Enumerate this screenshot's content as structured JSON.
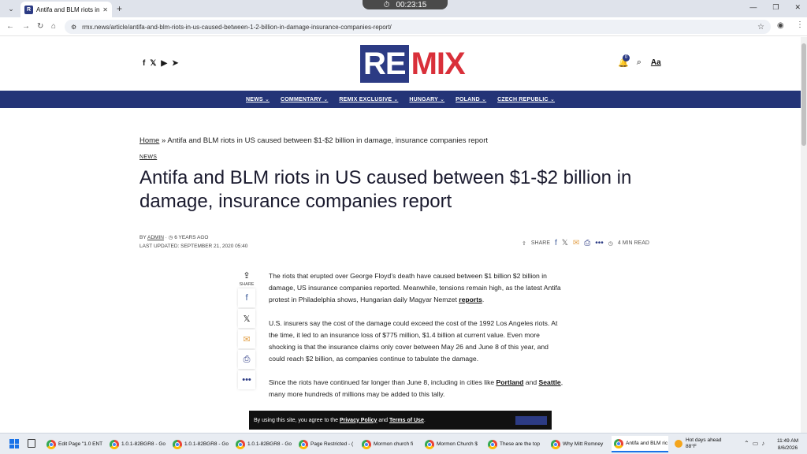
{
  "browser": {
    "tab_title": "Antifa and BLM riots in US caus",
    "tab_favicon": "R",
    "timer": "00:23:15",
    "url": "rmx.news/article/antifa-and-blm-riots-in-us-caused-between-1-2-billion-in-damage-insurance-companies-report/"
  },
  "site": {
    "logo_left": "RE",
    "logo_right": "MIX",
    "notif_count": "0",
    "font_toggle": "Aa",
    "nav": [
      "NEWS",
      "COMMENTARY",
      "REMIX EXCLUSIVE",
      "HUNGARY",
      "POLAND",
      "CZECH REPUBLIC"
    ],
    "brand_colors": {
      "navy": "#243477",
      "red": "#d9303a"
    }
  },
  "article": {
    "breadcrumb_home": "Home",
    "breadcrumb_rest": " » Antifa and BLM riots in US caused between $1-$2 billion in damage, insurance companies report",
    "category": "NEWS",
    "title": "Antifa and BLM riots in US caused between $1-$2 billion in damage, insurance companies report",
    "by": "BY ",
    "author": "ADMIN",
    "age": "6 YEARS AGO",
    "last_updated": "LAST UPDATED: SEPTEMBER 21, 2020 05:40",
    "share_label": "SHARE",
    "read_time": "4 MIN READ",
    "side_share_label": "SHARE",
    "p1_text": "The riots that erupted over George Floyd’s death have caused between $1 billion $2 billion in damage, US insurance companies reported. Meanwhile, tensions remain high, as the latest Antifa protest in Philadelphia shows, Hungarian daily Magyar Nemzet ",
    "p1_link": "reports",
    "p1_end": ".",
    "p2": "U.S. insurers say the cost of the damage could exceed the cost of the 1992 Los Angeles riots. At the time, it led to an insurance loss of $775 million, $1.4 billion at current value. Even more shocking is that the insurance claims only cover between May 26 and June 8 of this year, and could reach $2 billion, as companies continue to tabulate the damage.",
    "p3_a": "Since the riots have continued far longer than June 8, including in cities like ",
    "p3_link1": "Portland",
    "p3_b": " and ",
    "p3_link2": "Seattle",
    "p3_c": ", many more hundreds of millions may be added to this tally."
  },
  "cookie": {
    "text": "By using this site, you agree to the ",
    "privacy": "Privacy Policy",
    "and": " and ",
    "terms": "Terms of Use",
    "end": "."
  },
  "taskbar": {
    "items": [
      "Edit Page \"1.0 ENT",
      "1.0.1-82BGR8 - Go",
      "1.0.1-82BGR8 - Go",
      "1.0.1-82BGR8 - Go",
      "Page Restricted - (",
      "Mormon church fi",
      "Mormon Church $",
      "These are the top",
      "Why Mitt Romney",
      "Antifa and BLM ric"
    ],
    "weather_title": "Hot days ahead",
    "weather_temp": "88°F",
    "time": "11:49 AM",
    "date": "8/6/2026"
  }
}
